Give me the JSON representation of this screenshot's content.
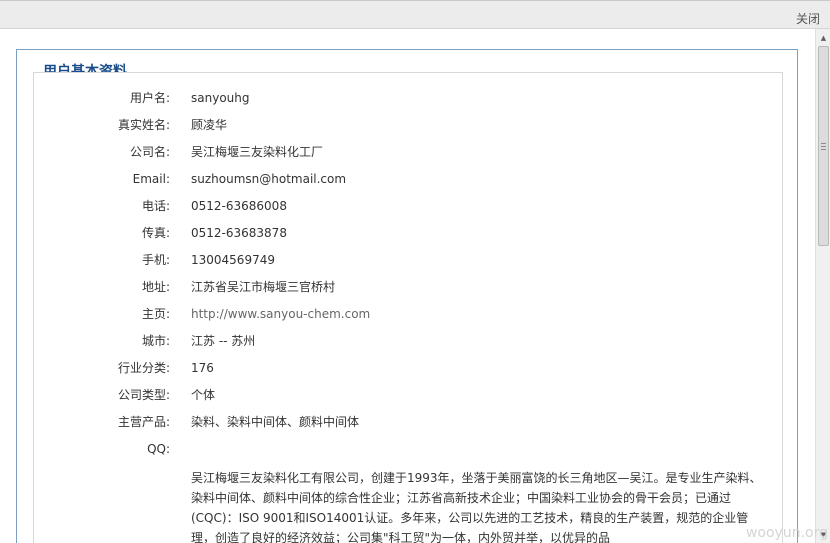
{
  "window": {
    "close_label": "关闭"
  },
  "section": {
    "title": "用户基本资料"
  },
  "profile": [
    {
      "label": "用户名:",
      "value": "sanyouhg"
    },
    {
      "label": "真实姓名:",
      "value": "顾凌华"
    },
    {
      "label": "公司名:",
      "value": "吴江梅堰三友染料化工厂"
    },
    {
      "label": "Email:",
      "value": "suzhoumsn@hotmail.com"
    },
    {
      "label": "电话:",
      "value": "0512-63686008"
    },
    {
      "label": "传真:",
      "value": "0512-63683878"
    },
    {
      "label": "手机:",
      "value": "13004569749"
    },
    {
      "label": "地址:",
      "value": "江苏省吴江市梅堰三官桥村"
    },
    {
      "label": "主页:",
      "value": "http://www.sanyou-chem.com"
    },
    {
      "label": "城市:",
      "value": "江苏 -- 苏州"
    },
    {
      "label": "行业分类:",
      "value": "176"
    },
    {
      "label": "公司类型:",
      "value": "个体"
    },
    {
      "label": "主营产品:",
      "value": "染料、染料中间体、颜料中间体"
    },
    {
      "label": "QQ:",
      "value": ""
    }
  ],
  "description": "吴江梅堰三友染料化工有限公司，创建于1993年，坐落于美丽富饶的长三角地区—吴江。是专业生产染料、染料中间体、颜料中间体的综合性企业；江苏省高新技术企业；中国染料工业协会的骨干会员；已通过(CQC)：ISO 9001和ISO14001认证。多年来，公司以先进的工艺技术，精良的生产装置，规范的企业管理，创造了良好的经济效益；公司集\"科工贸\"为一体，内外贸并举，以优异的品",
  "watermark": "wooyun.org"
}
